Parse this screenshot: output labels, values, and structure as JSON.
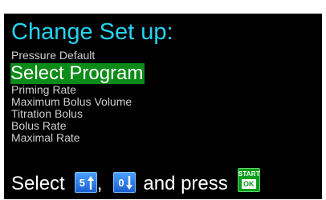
{
  "screen": {
    "title": "Change Set up:",
    "menu_items": [
      {
        "label": "Pressure Default",
        "selected": false
      },
      {
        "label": "Select Program",
        "selected": true
      },
      {
        "label": "Priming Rate",
        "selected": false
      },
      {
        "label": "Maximum Bolus Volume",
        "selected": false
      },
      {
        "label": "Titration Bolus",
        "selected": false
      },
      {
        "label": "Bolus Rate",
        "selected": false
      },
      {
        "label": "Maximal Rate",
        "selected": false
      }
    ],
    "footer": {
      "select_text": "Select",
      "comma": ",",
      "press_text": "and press",
      "up_key_digit": "5",
      "down_key_digit": "0",
      "start_label": "START",
      "ok_label": "OK"
    }
  },
  "colors": {
    "background": "#000000",
    "title": "#27d3f0",
    "selection": "#0d8b18",
    "key_blue": "#1a5fd0",
    "key_green": "#0d9b1c"
  },
  "icons": [
    "up-arrow-icon",
    "down-arrow-icon",
    "start-ok-key-icon"
  ]
}
